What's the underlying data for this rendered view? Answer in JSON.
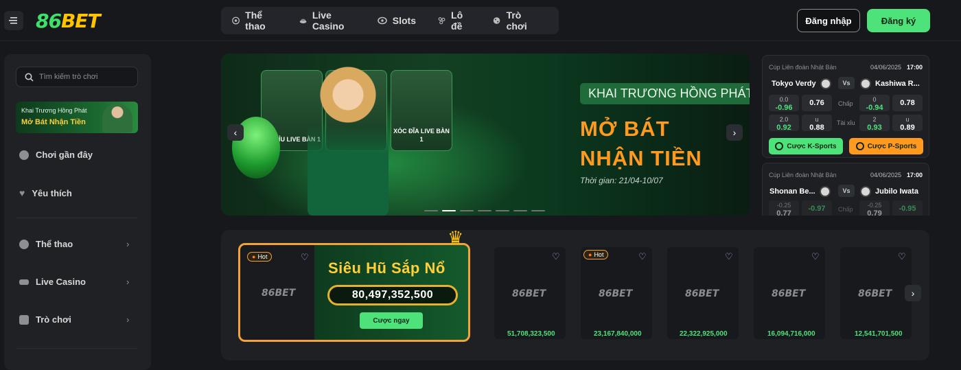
{
  "header": {
    "logo": {
      "part1": "86",
      "part2": "BET"
    },
    "nav": [
      {
        "label": "Thể thao",
        "icon": "soccer-ball-icon"
      },
      {
        "label": "Live Casino",
        "icon": "casino-chips-icon"
      },
      {
        "label": "Slots",
        "icon": "slot-icon"
      },
      {
        "label": "Lô đề",
        "icon": "lottery-balls-icon"
      },
      {
        "label": "Trò chơi",
        "icon": "dice-icon"
      }
    ],
    "login_label": "Đăng nhập",
    "register_label": "Đăng ký"
  },
  "sidebar": {
    "search_placeholder": "Tìm kiếm trò chơi",
    "promo": {
      "line1": "Khai Trương Hồng Phát",
      "line2": "Mở Bát Nhận Tiền"
    },
    "items": [
      {
        "label": "Chơi gần đây",
        "icon": "clock-icon"
      },
      {
        "label": "Yêu thích",
        "icon": "heart-icon"
      },
      {
        "label": "Thể thao",
        "icon": "soccer-ball-icon"
      },
      {
        "label": "Live Casino",
        "icon": "casino-chips-icon"
      },
      {
        "label": "Trò chơi",
        "icon": "dice-icon"
      }
    ]
  },
  "banner": {
    "cards": [
      "TÀI XỈU LIVE BÀN 1",
      "XÓC ĐĨA LIVE BÀN 1"
    ],
    "tag": "KHAI TRƯƠNG HỒNG PHÁT",
    "headline1": "MỞ BÁT",
    "headline2": "NHẬN TIỀN",
    "time": "Thời gian: 21/04-10/07",
    "slides": 7,
    "active_slide": 2
  },
  "matches": [
    {
      "league": "Cúp Liên đoàn Nhật Bản",
      "date": "04/06/2025",
      "time": "17:00",
      "home": "Tokyo Verdy",
      "away": "Kashiwa R...",
      "vs": "Vs",
      "handicap_label": "Chấp",
      "total_label": "Tài xỉu",
      "h1_top": "0.0",
      "h1_val": "-0.96",
      "h2_val": "0.76",
      "a1_top": "0",
      "a1_val": "-0.94",
      "a2_val": "0.78",
      "t1_top": "2.0",
      "t1_val": "0.92",
      "t2_top": "u",
      "t2_val": "0.88",
      "t3_top": "2",
      "t3_val": "0.93",
      "t4_top": "u",
      "t4_val": "0.89",
      "btn_k": "Cược K-Sports",
      "btn_p": "Cược P-Sports"
    },
    {
      "league": "Cúp Liên đoàn Nhật Bản",
      "date": "04/06/2025",
      "time": "17:00",
      "home": "Shonan Be...",
      "away": "Jubilo Iwata",
      "vs": "Vs",
      "handicap_label": "Chấp",
      "h1_top": "-0.25",
      "h1_val": "0.77",
      "h2_val": "-0.97",
      "a1_top": "-0.25",
      "a1_val": "0.79",
      "a2_val": "-0.95"
    }
  ],
  "jackpot": {
    "hot_label": "Hot",
    "title": "Siêu Hũ Sắp Nổ",
    "amount": "80,497,352,500",
    "bet_label": "Cược ngay",
    "logo_text": "86BET",
    "games": [
      {
        "value": "51,708,323,500",
        "hot": false
      },
      {
        "value": "23,167,840,000",
        "hot": true
      },
      {
        "value": "22,322,925,000",
        "hot": false
      },
      {
        "value": "16,094,716,000",
        "hot": false
      },
      {
        "value": "12,541,701,500",
        "hot": false
      }
    ]
  },
  "colors": {
    "accent": "#4ee37a",
    "orange": "#ff9a1f",
    "gold": "#ffc400",
    "bg": "#17181c"
  }
}
